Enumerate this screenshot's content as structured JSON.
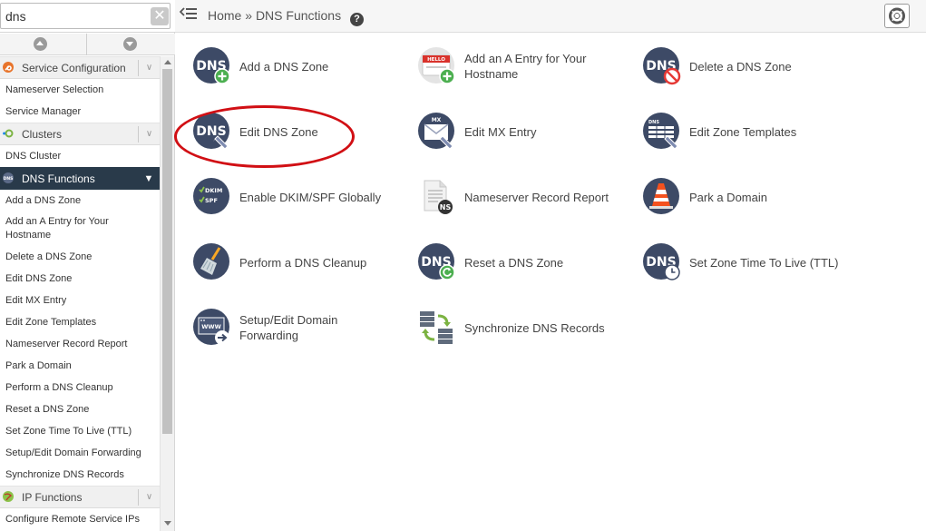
{
  "search": {
    "value": "dns",
    "clear_label": "✕"
  },
  "breadcrumb": {
    "home": "Home",
    "separator": "»",
    "current": "DNS Functions",
    "help": "?"
  },
  "sidebar": {
    "categories": [
      {
        "label": "Service Configuration",
        "items": [
          "Nameserver Selection",
          "Service Manager"
        ]
      },
      {
        "label": "Clusters",
        "items": [
          "DNS Cluster"
        ]
      },
      {
        "label": "DNS Functions",
        "items": [
          "Add a DNS Zone",
          "Add an A Entry for Your Hostname",
          "Delete a DNS Zone",
          "Edit DNS Zone",
          "Edit MX Entry",
          "Edit Zone Templates",
          "Nameserver Record Report",
          "Park a Domain",
          "Perform a DNS Cleanup",
          "Reset a DNS Zone",
          "Set Zone Time To Live (TTL)",
          "Setup/Edit Domain Forwarding",
          "Synchronize DNS Records"
        ]
      },
      {
        "label": "IP Functions",
        "items": [
          "Configure Remote Service IPs"
        ]
      }
    ]
  },
  "tiles": [
    {
      "label": "Add a DNS Zone",
      "icon": "dns-add-icon"
    },
    {
      "label": "Add an A Entry for Your Hostname",
      "icon": "hello-badge-add-icon",
      "badge_text": "HELLO"
    },
    {
      "label": "Delete a DNS Zone",
      "icon": "dns-delete-icon"
    },
    {
      "label": "Edit DNS Zone",
      "icon": "dns-edit-icon"
    },
    {
      "label": "Edit MX Entry",
      "icon": "mx-envelope-icon",
      "badge_text": "MX"
    },
    {
      "label": "Edit Zone Templates",
      "icon": "zone-template-icon"
    },
    {
      "label": "Enable DKIM/SPF Globally",
      "icon": "dkim-spf-icon",
      "badge_text": [
        "DKIM",
        "SPF"
      ]
    },
    {
      "label": "Nameserver Record Report",
      "icon": "ns-report-icon",
      "badge_text": "NS"
    },
    {
      "label": "Park a Domain",
      "icon": "traffic-cone-icon"
    },
    {
      "label": "Perform a DNS Cleanup",
      "icon": "broom-icon"
    },
    {
      "label": "Reset a DNS Zone",
      "icon": "dns-reset-icon"
    },
    {
      "label": "Set Zone Time To Live (TTL)",
      "icon": "dns-clock-icon"
    },
    {
      "label": "Setup/Edit Domain Forwarding",
      "icon": "www-forward-icon",
      "badge_text": "WWW"
    },
    {
      "label": "Synchronize DNS Records",
      "icon": "sync-servers-icon"
    }
  ],
  "icon_text": {
    "dns": "DNS"
  },
  "colors": {
    "nav_active": "#293a4a",
    "icon_circle": "#3d4a66",
    "add_green": "#4caf50",
    "delete_red": "#e53935",
    "highlight": "#d10f14"
  }
}
